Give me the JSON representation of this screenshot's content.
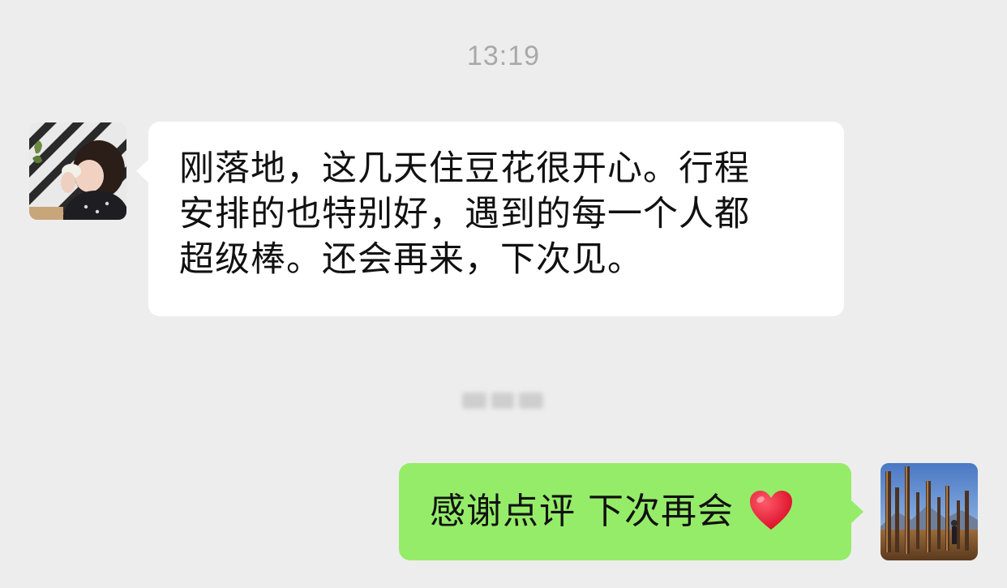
{
  "chat": {
    "timestamp": "13:19",
    "incoming": {
      "text": "刚落地，这几天住豆花很开心。行程\n安排的也特别好，遇到的每一个人都\n超级棒。还会再来，下次见。"
    },
    "outgoing": {
      "text": "感谢点评 下次再会",
      "emoji": "red-heart"
    },
    "obscured_label": {
      "state": "blurred"
    }
  },
  "colors": {
    "background": "#ededed",
    "incoming_bubble": "#ffffff",
    "outgoing_bubble": "#95ec69",
    "timestamp_text": "#a9a9a9",
    "heart": "#e8112d"
  },
  "icons": {
    "incoming_avatar": "girl-photo-avatar",
    "outgoing_avatar": "landscape-photo-avatar",
    "emoji": "red-heart-icon"
  }
}
